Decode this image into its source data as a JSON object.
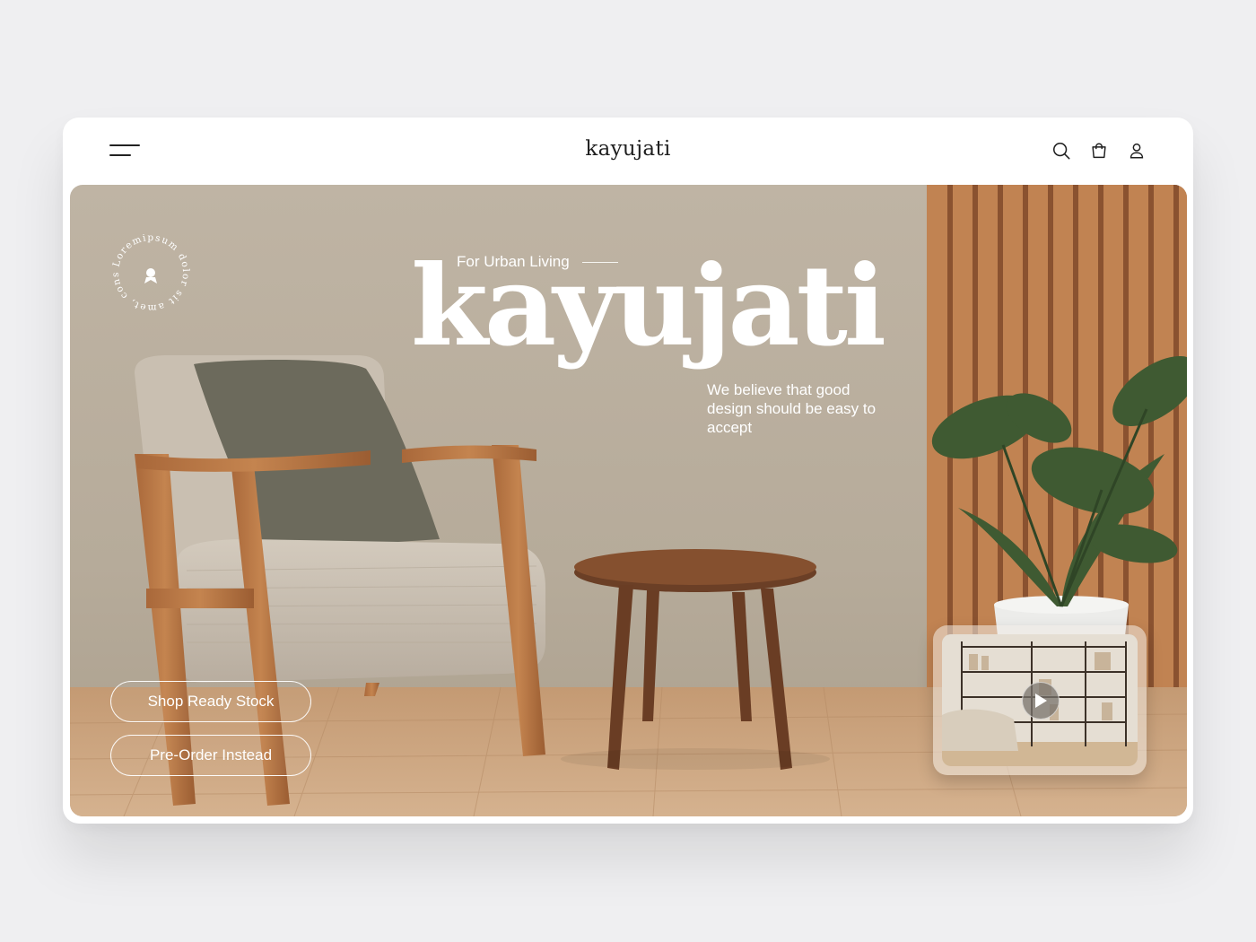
{
  "header": {
    "brand": "kayujati",
    "icons": [
      "menu-icon",
      "search-icon",
      "bag-icon",
      "user-icon"
    ]
  },
  "hero": {
    "tagline": "For Urban Living",
    "title": "kayujati",
    "subtitle": "We believe that good design should be easy to accept",
    "badge_text": "Loremipsum dolor sit amet, cons",
    "cta_primary": "Shop Ready Stock",
    "cta_secondary": "Pre-Order Instead",
    "video_icon": "play-icon"
  },
  "colors": {
    "wall": "#bfb4a4",
    "wood": "#b0713f",
    "floor": "#c9a07a",
    "text_light": "#ffffff"
  }
}
